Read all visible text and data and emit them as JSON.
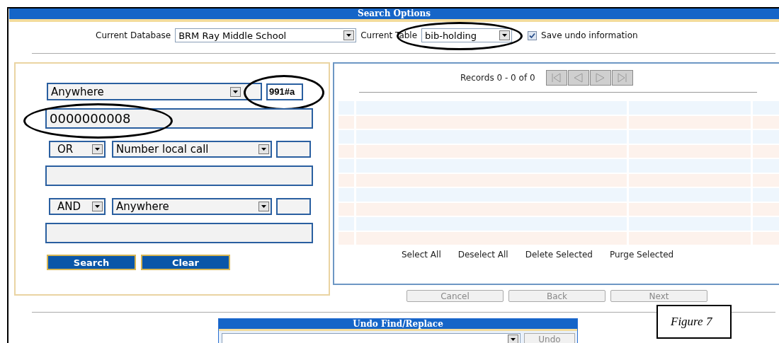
{
  "header": {
    "title": "Search Options"
  },
  "database": {
    "label": "Current Database",
    "value": "BRM Ray Middle School"
  },
  "table": {
    "label": "Current Table",
    "value": "bib-holding",
    "circled": true
  },
  "save_undo": {
    "label": "Save undo information",
    "checked": true
  },
  "criteria": [
    {
      "kind": "first",
      "field": "Anywhere",
      "tag": "991#a",
      "tag_circled": true,
      "term": "0000000008",
      "term_circled": true
    },
    {
      "kind": "joined",
      "operator": "OR",
      "field": "Number local call"
    },
    {
      "kind": "joined",
      "operator": "AND",
      "field": "Anywhere"
    }
  ],
  "search_buttons": [
    "Search",
    "Clear"
  ],
  "results": {
    "records": "Records 0 - 0 of 0",
    "nav": [
      {
        "kind": "first",
        "disabled": true
      },
      {
        "kind": "prev",
        "disabled": true
      },
      {
        "kind": "next",
        "disabled": true
      },
      {
        "kind": "last",
        "disabled": true
      }
    ],
    "actions": [
      "Select All",
      "Deselect All",
      "Delete Selected",
      "Purge Selected"
    ]
  },
  "wizard_buttons": [
    {
      "label": "Cancel",
      "disabled": true
    },
    {
      "label": "Back",
      "disabled": true
    },
    {
      "label": "Next",
      "disabled": true
    }
  ],
  "undo": {
    "title": "Undo Find/Replace",
    "button": {
      "label": "Undo",
      "disabled": true
    }
  },
  "caption": "Figure 7"
}
